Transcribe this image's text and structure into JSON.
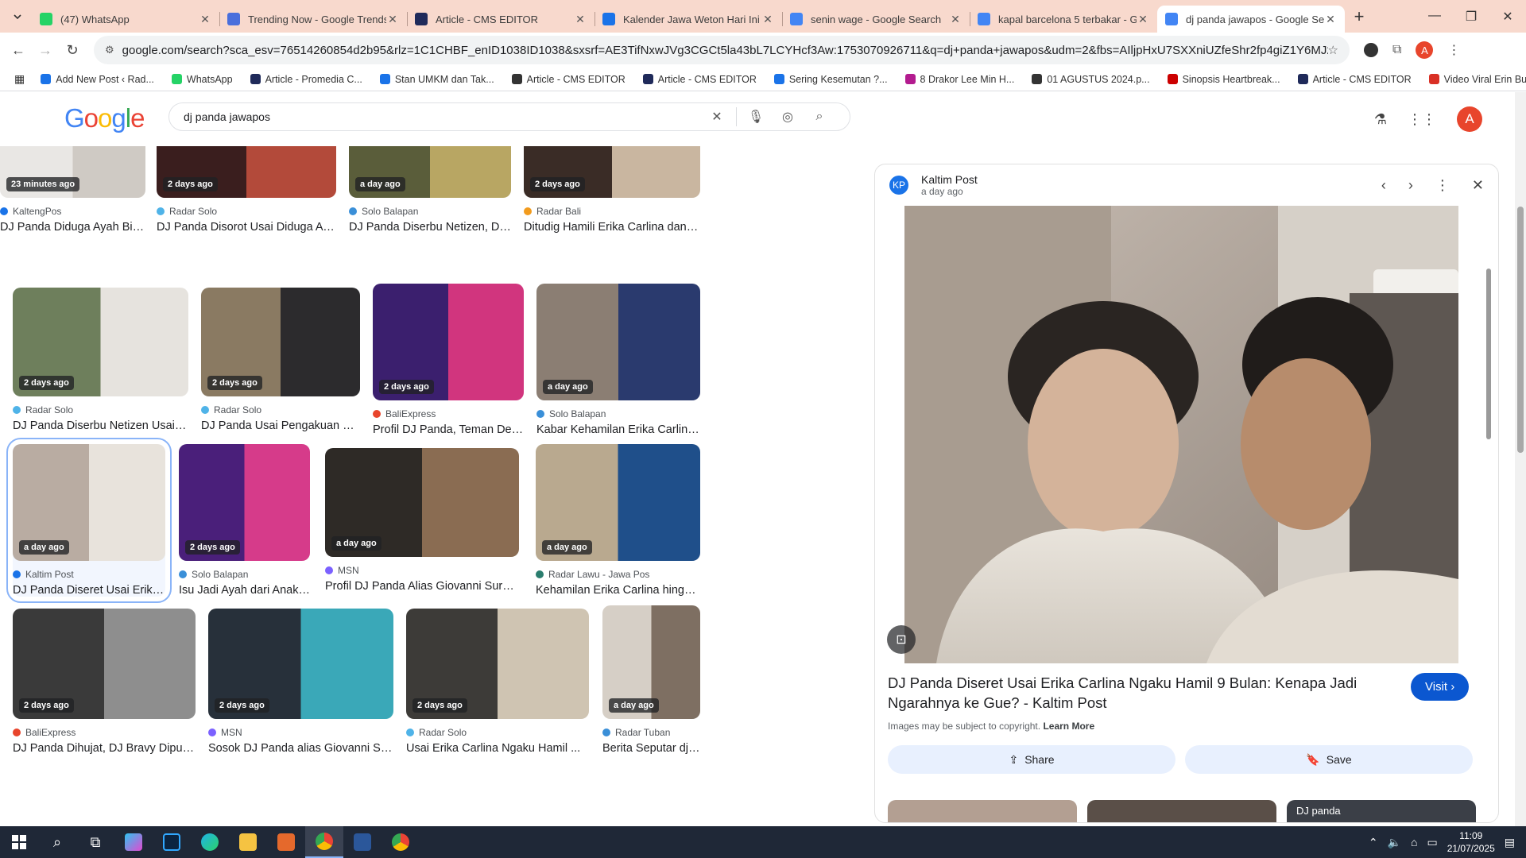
{
  "browser": {
    "tabs": [
      {
        "title": "(47) WhatsApp",
        "favicon_color": "#25d366"
      },
      {
        "title": "Trending Now - Google Trends",
        "favicon_color": "#4a6fdc"
      },
      {
        "title": "Article - CMS EDITOR",
        "favicon_color": "#1f2a5a"
      },
      {
        "title": "Kalender Jawa Weton Hari Ini J",
        "favicon_color": "#1a73e8"
      },
      {
        "title": "senin wage - Google Search",
        "favicon_color": "#4285f4"
      },
      {
        "title": "kapal barcelona 5 terbakar - Go",
        "favicon_color": "#4285f4"
      },
      {
        "title": "dj panda jawapos - Google Sea",
        "favicon_color": "#4285f4"
      }
    ],
    "address": "google.com/search?sca_esv=76514260854d2b95&rlz=1C1CHBF_enID1038ID1038&sxsrf=AE3TifNxwJVg3CGCt5la43bL7LCYHcf3Aw:1753070926711&q=dj+panda+jawapos&udm=2&fbs=AIljpHxU7SXXniUZfeShr2fp4giZ1Y6MJ25_tmWITc7uy4KIeqDdE...",
    "profile_letter": "A",
    "bookmarks": [
      {
        "label": "Add New Post ‹ Rad...",
        "color": "#1a73e8"
      },
      {
        "label": "WhatsApp",
        "color": "#25d366"
      },
      {
        "label": "Article - Promedia C...",
        "color": "#1f2a5a"
      },
      {
        "label": "Stan UMKM dan Tak...",
        "color": "#1a73e8"
      },
      {
        "label": "Article - CMS EDITOR",
        "color": "#333333"
      },
      {
        "label": "Article - CMS EDITOR",
        "color": "#1f2a5a"
      },
      {
        "label": "Sering Kesemutan ?...",
        "color": "#1a73e8"
      },
      {
        "label": "8 Drakor Lee Min H...",
        "color": "#b31b8f"
      },
      {
        "label": "01 AGUSTUS 2024.p...",
        "color": "#333333"
      },
      {
        "label": "Sinopsis Heartbreak...",
        "color": "#cc0000"
      },
      {
        "label": "Article - CMS EDITOR",
        "color": "#1f2a5a"
      },
      {
        "label": "Video Viral Erin Bug...",
        "color": "#d93025"
      }
    ]
  },
  "google": {
    "logo": "Google",
    "query": "dj panda jawapos",
    "avatar_letter": "A"
  },
  "results": [
    {
      "time": "23 minutes ago",
      "source": "KaltengPos",
      "caption": "DJ Panda Diduga Ayah Biol...",
      "c1": "#e9e7e4",
      "c2": "#cfcac4",
      "sc": "#1a73e8"
    },
    {
      "time": "2 days ago",
      "source": "Radar Solo",
      "caption": "DJ Panda Disorot Usai Diduga Ayah An...",
      "c1": "#3a1e1e",
      "c2": "#b34a3a",
      "sc": "#4fb3e8"
    },
    {
      "time": "a day ago",
      "source": "Solo Balapan",
      "caption": "DJ Panda Diserbu Netizen, Ditudin...",
      "c1": "#5a5d3a",
      "c2": "#b8a663",
      "sc": "#3a8fd8"
    },
    {
      "time": "2 days ago",
      "source": "Radar Bali",
      "caption": "Ditudig Hamili Erika Carlina dan Tak ...",
      "c1": "#3a2c26",
      "c2": "#c9b6a0",
      "sc": "#f29b1d"
    },
    {
      "time": "2 days ago",
      "source": "Radar Solo",
      "caption": "DJ Panda Diserbu Netizen Usai Erika ...",
      "c1": "#6e7f5c",
      "c2": "#e6e3de",
      "sc": "#4fb3e8"
    },
    {
      "time": "2 days ago",
      "source": "Radar Solo",
      "caption": "DJ Panda Usai Pengakuan Erika ...",
      "c1": "#8a7a62",
      "c2": "#2c2b2d",
      "sc": "#4fb3e8"
    },
    {
      "time": "2 days ago",
      "source": "BaliExpress",
      "caption": "Profil DJ Panda, Teman Dekat Er...",
      "c1": "#3b1f6e",
      "c2": "#d1357e",
      "sc": "#e8452c"
    },
    {
      "time": "a day ago",
      "source": "Solo Balapan",
      "caption": "Kabar Kehamilan Erika Carlina ...",
      "c1": "#8b7e73",
      "c2": "#2a3a6e",
      "sc": "#3a8fd8"
    },
    {
      "time": "a day ago",
      "source": "Kaltim Post",
      "caption": "DJ Panda Diseret Usai Erika Car...",
      "c1": "#b9aca2",
      "c2": "#e8e3dc",
      "sc": "#1a73e8"
    },
    {
      "time": "2 days ago",
      "source": "Solo Balapan",
      "caption": "Isu Jadi Ayah dari Anak Erik...",
      "c1": "#4a1f7a",
      "c2": "#d63b8a",
      "sc": "#3a8fd8"
    },
    {
      "time": "a day ago",
      "source": "MSN",
      "caption": "Profil DJ Panda Alias Giovanni Surya ...",
      "c1": "#2e2a26",
      "c2": "#8a6c52",
      "sc": "#7b61ff"
    },
    {
      "time": "a day ago",
      "source": "Radar Lawu - Jawa Pos",
      "caption": "Kehamilan Erika Carlina hingga ...",
      "c1": "#b9a98f",
      "c2": "#1f4f8a",
      "sc": "#2a7d6e"
    },
    {
      "time": "2 days ago",
      "source": "BaliExpress",
      "caption": "DJ Panda Dihujat, DJ Bravy Dipuji ...",
      "c1": "#3a3a3a",
      "c2": "#8e8e8e",
      "sc": "#e8452c"
    },
    {
      "time": "2 days ago",
      "source": "MSN",
      "caption": "Sosok DJ Panda alias Giovanni Surya ...",
      "c1": "#27303a",
      "c2": "#3aa8b8",
      "sc": "#7b61ff"
    },
    {
      "time": "2 days ago",
      "source": "Radar Solo",
      "caption": "Usai Erika Carlina Ngaku Hamil ...",
      "c1": "#3d3b38",
      "c2": "#cfc4b2",
      "sc": "#4fb3e8"
    },
    {
      "time": "a day ago",
      "source": "Radar Tuban",
      "caption": "Berita Seputar dj pa...",
      "c1": "#d6cfc6",
      "c2": "#7e6f62",
      "sc": "#3a8fd8"
    }
  ],
  "preview": {
    "source": "Kaltim Post",
    "time": "a day ago",
    "logo_letter": "KP",
    "title": "DJ Panda Diseret Usai Erika Carlina Ngaku Hamil 9 Bulan: Kenapa Jadi Ngarahnya ke Gue? - Kaltim Post",
    "visit_label": "Visit",
    "copyright": "Images may be subject to copyright.",
    "learn_more": "Learn More",
    "share_label": "Share",
    "save_label": "Save",
    "related_label": "DJ panda"
  },
  "taskbar": {
    "time": "11:09",
    "date": "21/07/2025"
  }
}
